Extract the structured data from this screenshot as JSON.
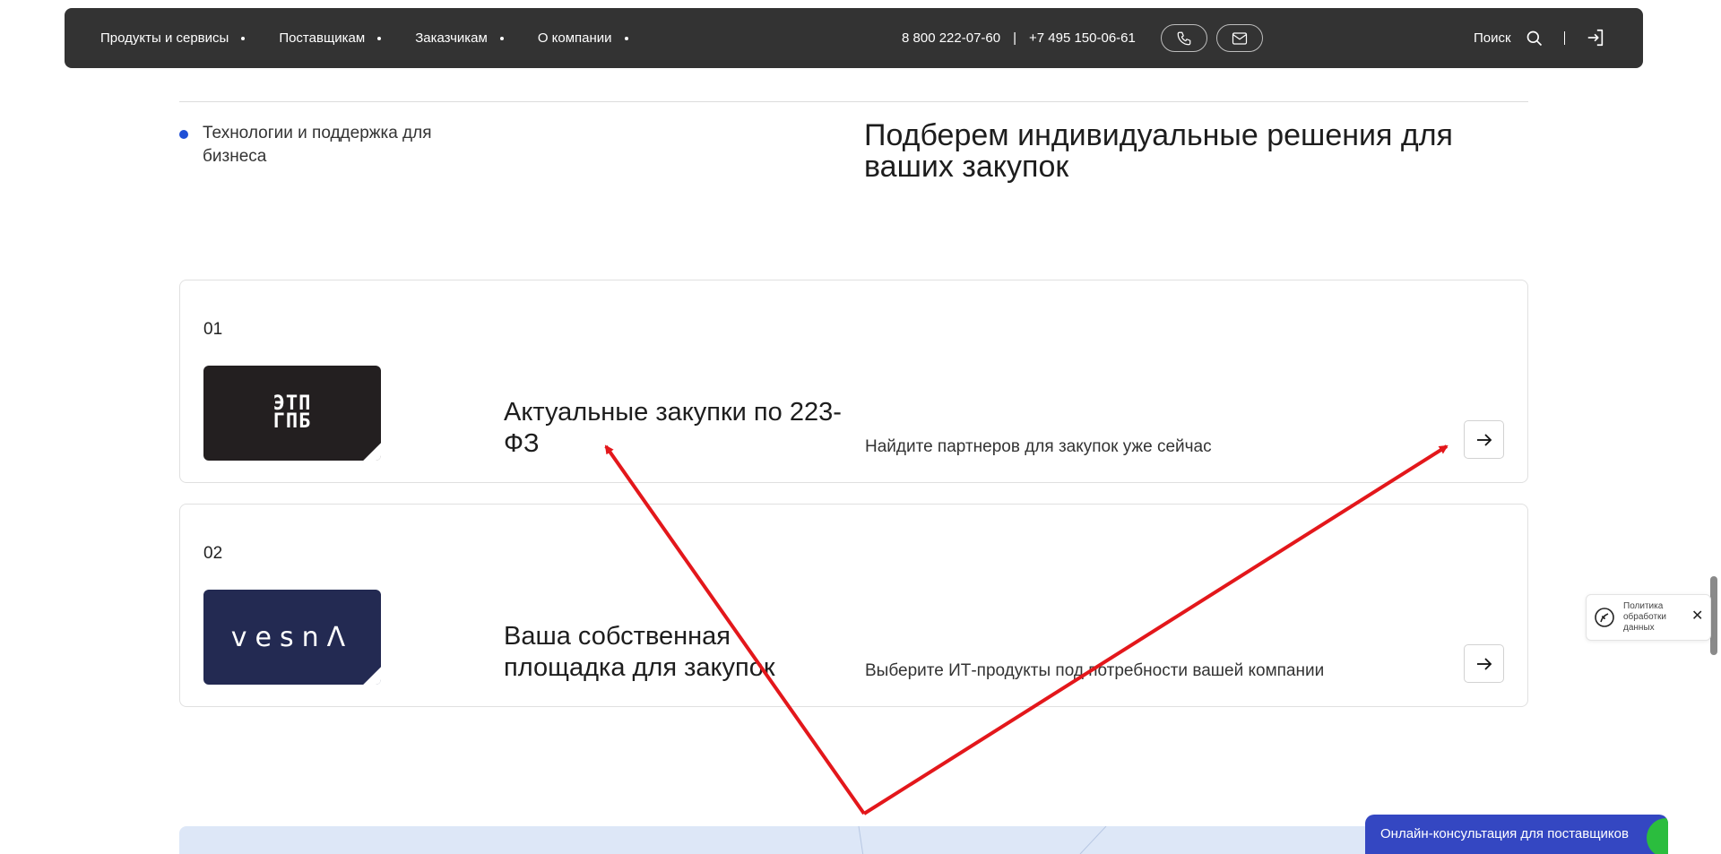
{
  "header": {
    "nav": [
      {
        "label": "Продукты и сервисы"
      },
      {
        "label": "Поставщикам"
      },
      {
        "label": "Заказчикам"
      },
      {
        "label": "О компании"
      }
    ],
    "phone_primary": "8 800 222-07-60",
    "phone_separator": "|",
    "phone_secondary": "+7 495 150-06-61",
    "search_label": "Поиск",
    "icons": {
      "call": "phone-icon",
      "mail": "mail-icon",
      "search": "search-icon",
      "login": "login-icon"
    }
  },
  "section": {
    "label": "Технологии и поддержка для бизнеса",
    "heading": "Подберем индивидуальные решения для ваших закупок"
  },
  "cards": [
    {
      "number": "01",
      "logo_text_line1": "ЭТП",
      "logo_text_line2": "ГПБ",
      "logo_bg": "#231f20",
      "title": "Актуальные закупки по 223-ФЗ",
      "description": "Найдите партнеров для закупок уже сейчас"
    },
    {
      "number": "02",
      "logo_text": "vesnΛ",
      "logo_bg": "#232a52",
      "title": "Ваша собственная площадка для закупок",
      "description": "Выберите ИТ-продукты под потребности вашей компании"
    }
  ],
  "policy_widget": {
    "text": "Политика обработки данных",
    "close": "✕"
  },
  "consult_button": {
    "label": "Онлайн-консультация для поставщиков"
  },
  "colors": {
    "header_bg": "#333333",
    "accent_blue": "#1f4fd6",
    "consult_bg": "#3447c2",
    "consult_accent": "#2bbd3e",
    "annotation_red": "#e3171b"
  }
}
